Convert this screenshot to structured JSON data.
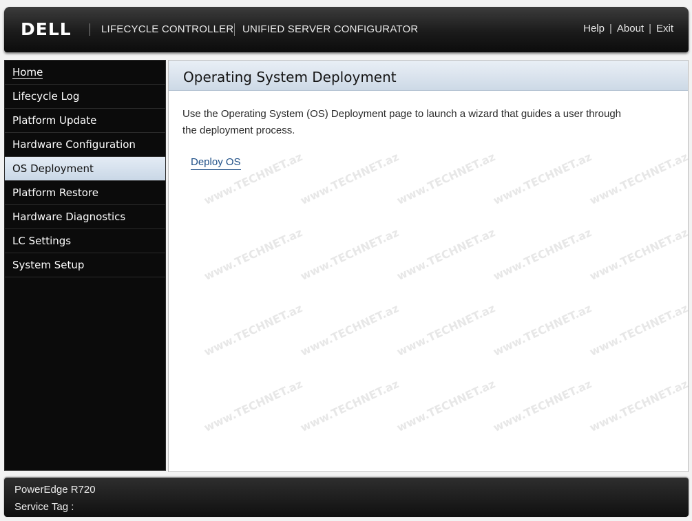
{
  "header": {
    "logo": "DELL",
    "product_primary": "LIFECYCLE CONTROLLER",
    "product_secondary": "UNIFIED SERVER CONFIGURATOR",
    "links": {
      "help": "Help",
      "about": "About",
      "exit": "Exit"
    }
  },
  "sidebar": {
    "items": [
      {
        "label": "Home"
      },
      {
        "label": "Lifecycle Log"
      },
      {
        "label": "Platform Update"
      },
      {
        "label": "Hardware Configuration"
      },
      {
        "label": "OS Deployment"
      },
      {
        "label": "Platform Restore"
      },
      {
        "label": "Hardware Diagnostics"
      },
      {
        "label": "LC Settings"
      },
      {
        "label": "System Setup"
      }
    ],
    "active_item": "OS Deployment"
  },
  "main": {
    "title": "Operating System Deployment",
    "description": "Use the Operating System (OS) Deployment page to launch a wizard that guides a user through the deployment process.",
    "action_link": "Deploy OS"
  },
  "footer": {
    "model": "PowerEdge R720",
    "service_tag_label": "Service Tag :"
  },
  "watermark": {
    "text": "www.TECHNET.az"
  }
}
